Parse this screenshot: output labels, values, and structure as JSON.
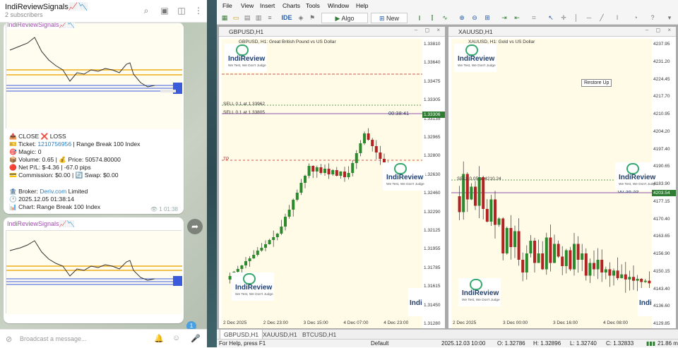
{
  "telegram": {
    "channel_title": "IndiReviewSignals📈📉",
    "subscribers": "2 subscribers",
    "message1": {
      "sender": "IndiReviewSignals📈📉",
      "lines": [
        {
          "pre": "📤 CLOSE ❌ LOSS",
          "link": "",
          "post": ""
        },
        {
          "pre": "🎫 Ticket: ",
          "link": "1210756956",
          "post": " | Range Break 100 Index"
        },
        {
          "pre": "🎯 Magic: 0",
          "link": "",
          "post": ""
        },
        {
          "pre": "📦 Volume: 0.65 | 💰 Price: 50574.80000",
          "link": "",
          "post": ""
        },
        {
          "pre": "🔴 Net P/L: $-4.36 | -67.0 pips",
          "link": "",
          "post": ""
        },
        {
          "pre": "💳 Commission: $0.00 | 🔄 Swap: $0.00",
          "link": "",
          "post": ""
        },
        {
          "pre": "",
          "link": "",
          "post": ""
        },
        {
          "pre": "🏦 Broker: ",
          "link": "Deriv.com",
          "post": " Limited"
        },
        {
          "pre": "🕐 2025.12.05 01:38:14",
          "link": "",
          "post": ""
        },
        {
          "pre": "📊 Chart: Range Break 100 Index",
          "link": "",
          "post": ""
        }
      ],
      "views": "1",
      "time": "01:38"
    },
    "message2": {
      "sender": "IndiReviewSignals📈📉"
    },
    "unread_count": "1",
    "input_placeholder": "Broadcast a message..."
  },
  "terminal": {
    "menu": [
      "File",
      "View",
      "Insert",
      "Charts",
      "Tools",
      "Window",
      "Help"
    ],
    "toolbar": {
      "ide": "IDE",
      "algo_trading": "Algo Trading",
      "new_order": "New Order"
    },
    "chart1": {
      "window_title": "GBPUSD,H1",
      "description": "GBPUSD, H1: Great British Pound vs US Dollar",
      "sell1": "SELL 0.1 at 1.33962",
      "sell2": "SELL 0.1 at 1.33805",
      "tp": "TP",
      "countdown": "00:38:41",
      "current_price": "1.33306",
      "price_labels": [
        "1.33810",
        "1.33640",
        "1.33475",
        "1.33305",
        "1.33135",
        "1.32965",
        "1.32800",
        "1.32630",
        "1.32460",
        "1.32290",
        "1.32125",
        "1.31955",
        "1.31785",
        "1.31615",
        "1.31450",
        "1.31280"
      ],
      "time_labels": [
        "2 Dec 2025",
        "2 Dec 23:00",
        "3 Dec 15:00",
        "4 Dec 07:00",
        "4 Dec 23:00"
      ]
    },
    "chart2": {
      "window_title": "XAUUSD,H1",
      "description": "XAUUSD, H1: Gold vs US Dollar",
      "sell_line": "SELL 0.05 at 4210.24",
      "countdown": "00:38:39",
      "current_price": "4203.54",
      "tooltip": "Restore Up",
      "price_labels": [
        "4237.95",
        "4231.20",
        "4224.45",
        "4217.70",
        "4210.95",
        "4204.20",
        "4197.40",
        "4190.65",
        "4183.90",
        "4177.15",
        "4170.40",
        "4163.65",
        "4156.90",
        "4150.15",
        "4143.40",
        "4136.60",
        "4129.85"
      ],
      "time_labels": [
        "2 Dec 2025",
        "3 Dec 00:00",
        "3 Dec 16:00",
        "4 Dec 08:00"
      ]
    },
    "indireview": {
      "name": "IndiReview",
      "tagline": "We Test, We Don't Judge"
    },
    "chart_tabs": [
      "GBPUSD,H1",
      "XAUUSD,H1",
      "BTCUSD,H1"
    ],
    "status": {
      "help": "For Help, press F1",
      "profile": "Default",
      "datetime": "2025.12.03 10:00",
      "open": "O: 1.32786",
      "high": "H: 1.32896",
      "low": "L: 1.32740",
      "close": "C: 1.32833",
      "speed": "21.86 ms"
    },
    "colors": {
      "bull": "#2b8a2b",
      "bear": "#b22222",
      "chart_bg": "#fffbe6",
      "sell_line": "#2e7d32",
      "position_line": "#6a1b9a",
      "price_tag": "#2e7d32"
    }
  }
}
